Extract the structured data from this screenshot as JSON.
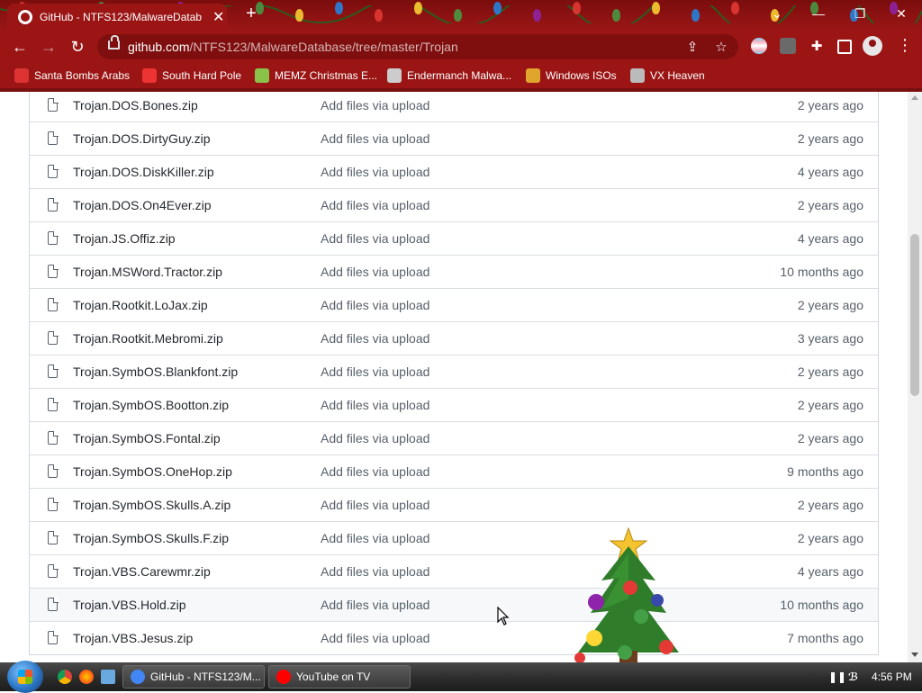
{
  "tab": {
    "title": "GitHub - NTFS123/MalwareDatab",
    "close": "✕",
    "new_tab": "+"
  },
  "window": {
    "chevron": "⌄",
    "minimize": "—",
    "restore": "❐",
    "close": "✕"
  },
  "toolbar": {
    "back": "←",
    "forward": "→",
    "reload": "↻",
    "menu": "⋮"
  },
  "omnibox": {
    "url_host": "github.com",
    "url_path": "/NTFS123/MalwareDatabase/tree/master/Trojan"
  },
  "bookmarks": [
    {
      "label": "Santa Bombs Arabs",
      "color": "#d33"
    },
    {
      "label": "South Hard Pole",
      "color": "#e33"
    },
    {
      "label": "MEMZ Christmas E...",
      "color": "#8bc34a"
    },
    {
      "label": "Endermanch Malwa...",
      "color": "#ccc"
    },
    {
      "label": "Windows ISOs",
      "color": "#e0a52c"
    },
    {
      "label": "VX Heaven",
      "color": "#bbb"
    }
  ],
  "files": [
    {
      "name": "Trojan.DOS.Bones.zip",
      "message": "Add files via upload",
      "age": "2 years ago"
    },
    {
      "name": "Trojan.DOS.DirtyGuy.zip",
      "message": "Add files via upload",
      "age": "2 years ago"
    },
    {
      "name": "Trojan.DOS.DiskKiller.zip",
      "message": "Add files via upload",
      "age": "4 years ago"
    },
    {
      "name": "Trojan.DOS.On4Ever.zip",
      "message": "Add files via upload",
      "age": "2 years ago"
    },
    {
      "name": "Trojan.JS.Offiz.zip",
      "message": "Add files via upload",
      "age": "4 years ago"
    },
    {
      "name": "Trojan.MSWord.Tractor.zip",
      "message": "Add files via upload",
      "age": "10 months ago"
    },
    {
      "name": "Trojan.Rootkit.LoJax.zip",
      "message": "Add files via upload",
      "age": "2 years ago"
    },
    {
      "name": "Trojan.Rootkit.Mebromi.zip",
      "message": "Add files via upload",
      "age": "3 years ago"
    },
    {
      "name": "Trojan.SymbOS.Blankfont.zip",
      "message": "Add files via upload",
      "age": "2 years ago"
    },
    {
      "name": "Trojan.SymbOS.Bootton.zip",
      "message": "Add files via upload",
      "age": "2 years ago"
    },
    {
      "name": "Trojan.SymbOS.Fontal.zip",
      "message": "Add files via upload",
      "age": "2 years ago"
    },
    {
      "name": "Trojan.SymbOS.OneHop.zip",
      "message": "Add files via upload",
      "age": "9 months ago"
    },
    {
      "name": "Trojan.SymbOS.Skulls.A.zip",
      "message": "Add files via upload",
      "age": "2 years ago"
    },
    {
      "name": "Trojan.SymbOS.Skulls.F.zip",
      "message": "Add files via upload",
      "age": "2 years ago"
    },
    {
      "name": "Trojan.VBS.Carewmr.zip",
      "message": "Add files via upload",
      "age": "4 years ago"
    },
    {
      "name": "Trojan.VBS.Hold.zip",
      "message": "Add files via upload",
      "age": "10 months ago"
    },
    {
      "name": "Trojan.VBS.Jesus.zip",
      "message": "Add files via upload",
      "age": "7 months ago"
    }
  ],
  "taskbar": {
    "tasks": [
      {
        "label": "GitHub - NTFS123/M...",
        "color": "#4285f4"
      },
      {
        "label": "YouTube on TV",
        "color": "#ff0000"
      }
    ],
    "clock": "4:56 PM"
  }
}
